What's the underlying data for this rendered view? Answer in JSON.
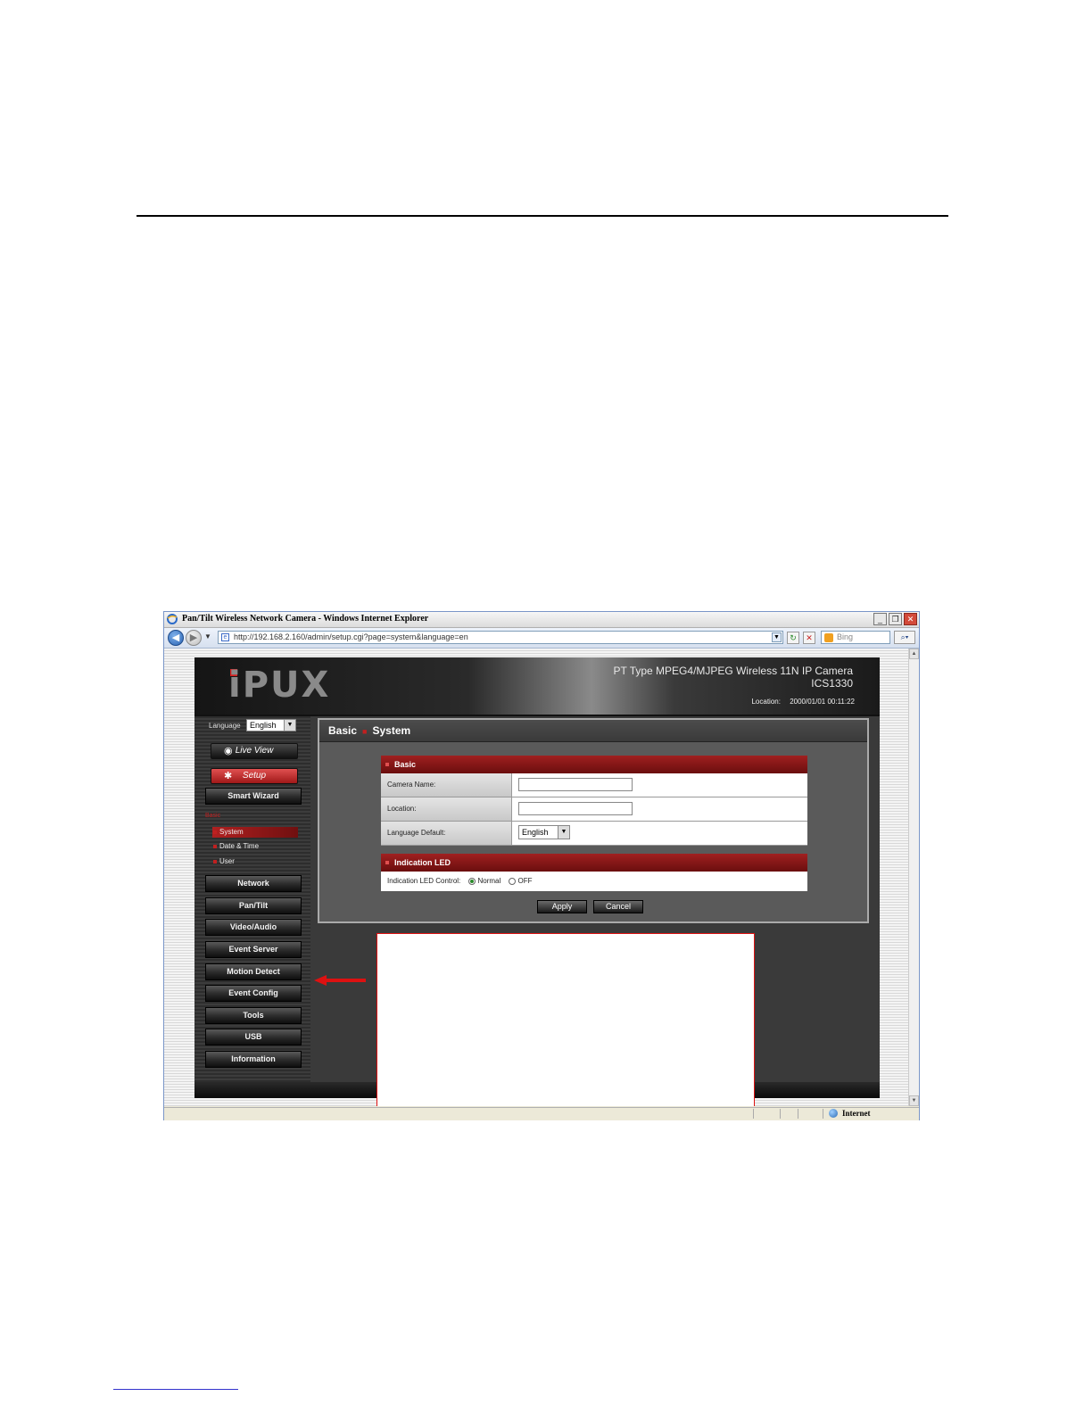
{
  "browser": {
    "window_title": "Pan/Tilt Wireless Network Camera - Windows Internet Explorer",
    "url": "http://192.168.2.160/admin/setup.cgi?page=system&language=en",
    "search_placeholder": "Bing",
    "status_zone": "Internet",
    "window_buttons": {
      "minimize": "_",
      "restore": "❐",
      "close": "✕"
    }
  },
  "header": {
    "logo": "iPUX",
    "product_line1": "PT Type MPEG4/MJPEG Wireless 11N IP Camera",
    "product_line2": "ICS1330",
    "location_label": "Location:",
    "datetime": "2000/01/01 00:11:22"
  },
  "sidebar": {
    "language_label": "Language",
    "language_value": "English",
    "live_view": "Live View",
    "setup": "Setup",
    "smart_wizard": "Smart Wizard",
    "basic_label": "Basic",
    "sub_items": [
      "System",
      "Date & Time",
      "User"
    ],
    "menu": [
      "Network",
      "Pan/Tilt",
      "Video/Audio",
      "Event Server",
      "Motion Detect",
      "Event Config",
      "Tools",
      "USB",
      "Information"
    ]
  },
  "content": {
    "breadcrumb": [
      "Basic",
      "System"
    ],
    "basic_panel": {
      "title": "Basic",
      "camera_name_label": "Camera Name:",
      "camera_name_value": "",
      "location_label": "Location:",
      "location_value": "",
      "language_default_label": "Language Default:",
      "language_default_value": "English"
    },
    "led_panel": {
      "title": "Indication LED",
      "control_label": "Indication LED Control:",
      "options": [
        "Normal",
        "OFF"
      ],
      "selected": "Normal"
    },
    "apply_label": "Apply",
    "cancel_label": "Cancel"
  },
  "colors": {
    "accent_red": "#a02020",
    "annotation_red": "#dd1111"
  },
  "icons": [
    "ie-icon",
    "back-icon",
    "forward-icon",
    "refresh-icon",
    "stop-icon",
    "bing-icon",
    "search-icon",
    "globe-icon",
    "eye-icon",
    "gear-icon",
    "arrow-icon"
  ]
}
